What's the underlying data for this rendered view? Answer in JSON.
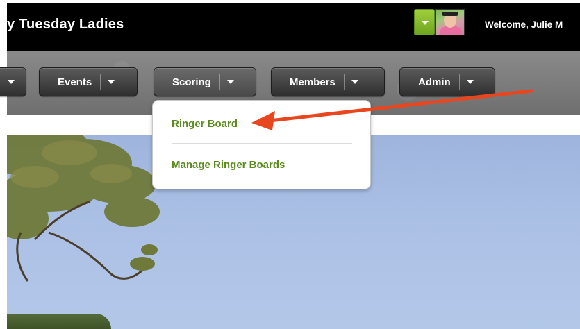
{
  "header": {
    "site_title": "y Tuesday Ladies",
    "welcome_text": "Welcome, Julie M"
  },
  "nav": {
    "items": [
      {
        "label": ""
      },
      {
        "label": "Events"
      },
      {
        "label": "Scoring"
      },
      {
        "label": "Members"
      },
      {
        "label": "Admin"
      }
    ]
  },
  "dropdown": {
    "items": [
      {
        "label": "Ringer Board"
      },
      {
        "label": "Manage Ringer Boards"
      }
    ]
  },
  "colors": {
    "menu_link": "#5b8b1e",
    "annotation_arrow": "#e8461e",
    "header_bg": "#000000",
    "user_toggle": "#86bb2c"
  },
  "icons": [
    "chevron-down-icon",
    "avatar"
  ]
}
